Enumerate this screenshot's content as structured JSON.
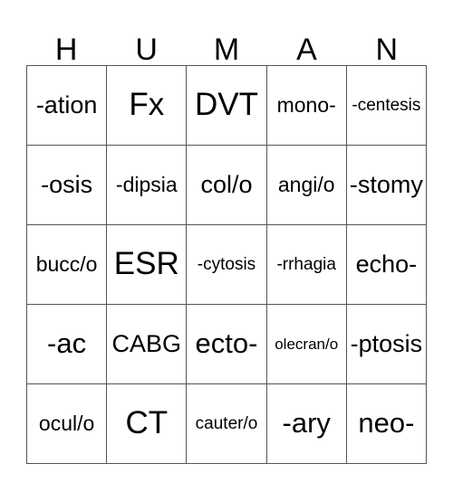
{
  "card": {
    "title_letters": [
      "H",
      "U",
      "M",
      "A",
      "N"
    ],
    "rows": [
      [
        {
          "text": "-ation",
          "size": "md"
        },
        {
          "text": "Fx",
          "size": "xl"
        },
        {
          "text": "DVT",
          "size": "xl"
        },
        {
          "text": "mono-",
          "size": "sm"
        },
        {
          "text": "-centesis",
          "size": "xs"
        }
      ],
      [
        {
          "text": "-osis",
          "size": "md"
        },
        {
          "text": "-dipsia",
          "size": "sm"
        },
        {
          "text": "col/o",
          "size": "md"
        },
        {
          "text": "angi/o",
          "size": "sm"
        },
        {
          "text": "-stomy",
          "size": "md"
        }
      ],
      [
        {
          "text": "bucc/o",
          "size": "sm"
        },
        {
          "text": "ESR",
          "size": "xl"
        },
        {
          "text": "-cytosis",
          "size": "xs"
        },
        {
          "text": "-rrhagia",
          "size": "xs"
        },
        {
          "text": "echo-",
          "size": "md"
        }
      ],
      [
        {
          "text": "-ac",
          "size": "lg"
        },
        {
          "text": "CABG",
          "size": "md"
        },
        {
          "text": "ecto-",
          "size": "lg"
        },
        {
          "text": "olecran/o",
          "size": "xxs"
        },
        {
          "text": "-ptosis",
          "size": "md"
        }
      ],
      [
        {
          "text": "ocul/o",
          "size": "sm"
        },
        {
          "text": "CT",
          "size": "xl"
        },
        {
          "text": "cauter/o",
          "size": "xs"
        },
        {
          "text": "-ary",
          "size": "lg"
        },
        {
          "text": "neo-",
          "size": "lg"
        }
      ]
    ]
  },
  "style": {
    "border_color": "#555555",
    "text_color": "#000000",
    "background_color": "#ffffff"
  }
}
